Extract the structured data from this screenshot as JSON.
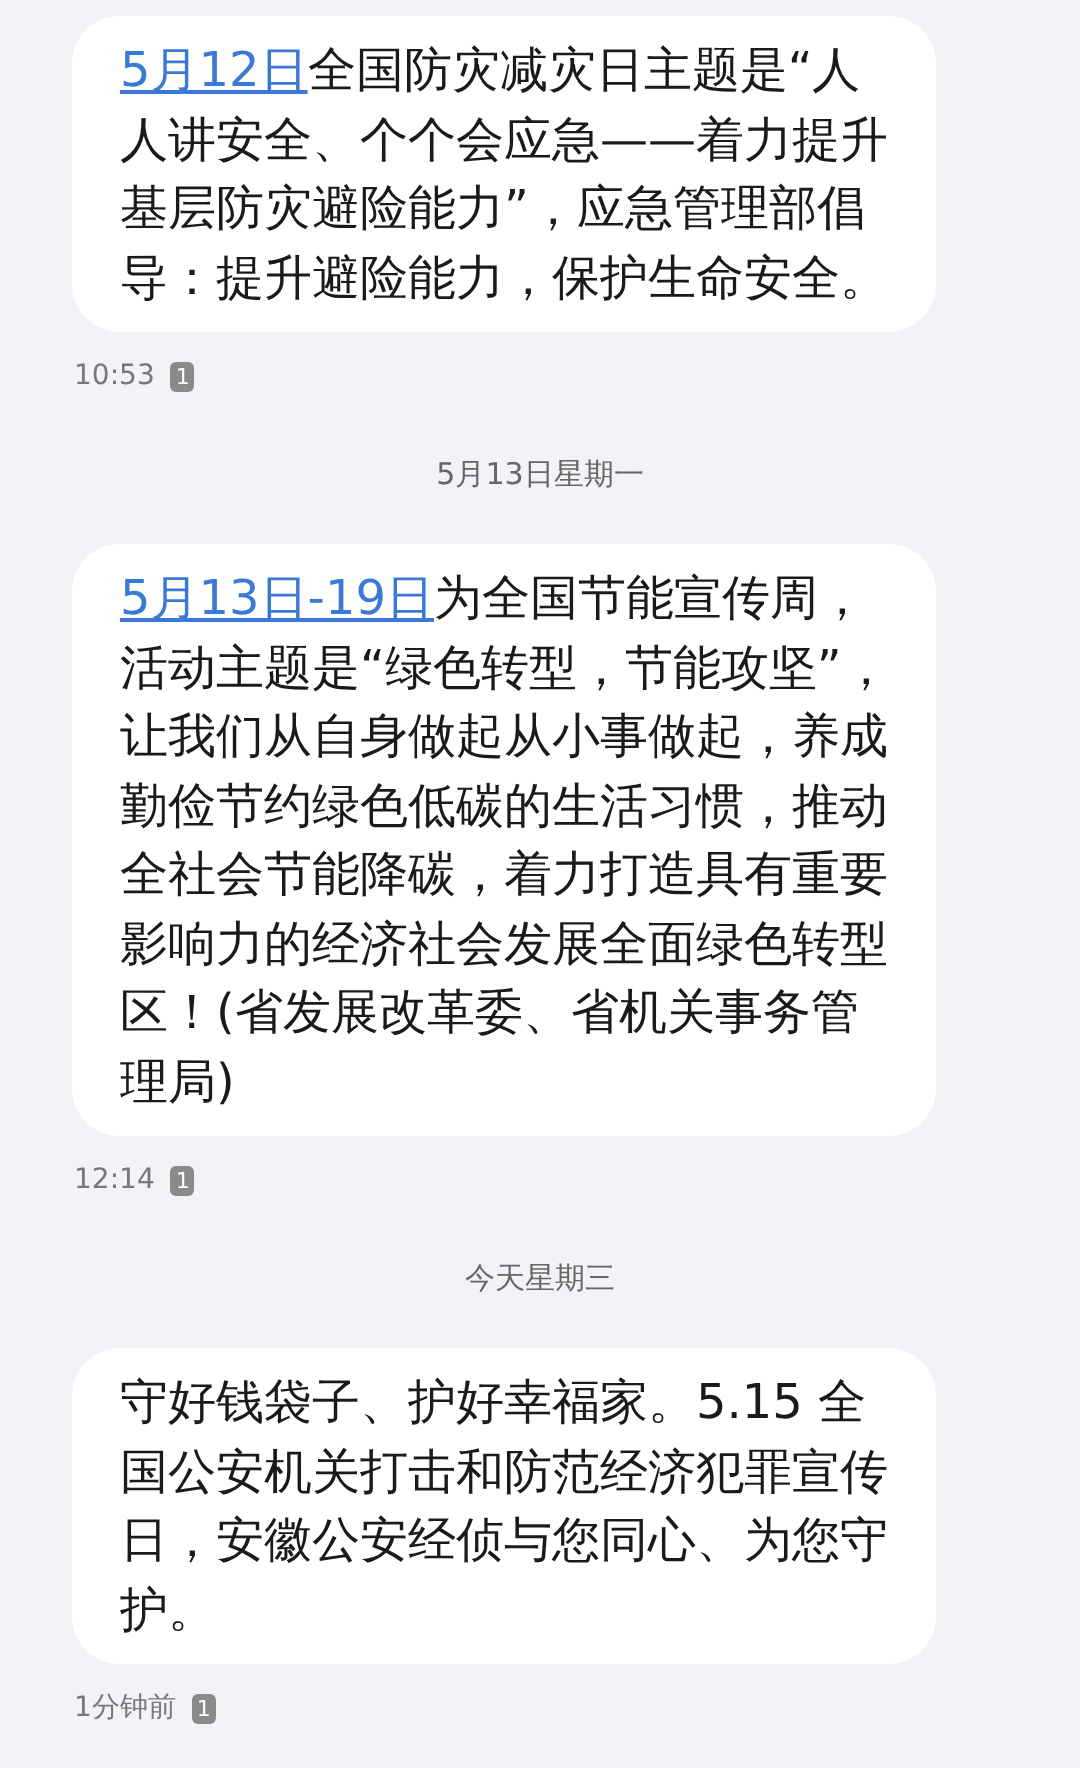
{
  "messages": [
    {
      "lines": [
        [
          {
            "kind": "link",
            "text": "5月12日"
          },
          {
            "kind": "text",
            "text": "全国防灾减灾日主题是“人"
          }
        ],
        [
          {
            "kind": "text",
            "text": "人讲安全、个个会应急——着力提升"
          }
        ],
        [
          {
            "kind": "text",
            "text": "基层防灾避险能力”，应急管理部倡"
          }
        ],
        [
          {
            "kind": "text",
            "text": "导：提升避险能力，保护生命安全。"
          }
        ]
      ],
      "time": "10:53",
      "sim": "1"
    },
    {
      "date_header": "5月13日星期一",
      "lines": [
        [
          {
            "kind": "link",
            "text": "5月13日-19日"
          },
          {
            "kind": "text",
            "text": "为全国节能宣传周，"
          }
        ],
        [
          {
            "kind": "text",
            "text": "活动主题是“绿色转型，节能攻坚”，"
          }
        ],
        [
          {
            "kind": "text",
            "text": "让我们从自身做起从小事做起，养成"
          }
        ],
        [
          {
            "kind": "text",
            "text": "勤俭节约绿色低碳的生活习惯，推动"
          }
        ],
        [
          {
            "kind": "text",
            "text": "全社会节能降碳，着力打造具有重要"
          }
        ],
        [
          {
            "kind": "text",
            "text": "影响力的经济社会发展全面绿色转型"
          }
        ],
        [
          {
            "kind": "text",
            "text": "区！(省发展改革委、省机关事务管"
          }
        ],
        [
          {
            "kind": "text",
            "text": "理局)"
          }
        ]
      ],
      "time": "12:14",
      "sim": "1"
    },
    {
      "date_header": "今天星期三",
      "lines": [
        [
          {
            "kind": "text",
            "text": "守好钱袋子、护好幸福家。5.15 全"
          }
        ],
        [
          {
            "kind": "text",
            "text": "国公安机关打击和防范经济犯罪宣传"
          }
        ],
        [
          {
            "kind": "text",
            "text": "日，安徽公安经侦与您同心、为您守"
          }
        ],
        [
          {
            "kind": "text",
            "text": "护。"
          }
        ]
      ],
      "time": "1分钟前",
      "sim": "1"
    }
  ]
}
